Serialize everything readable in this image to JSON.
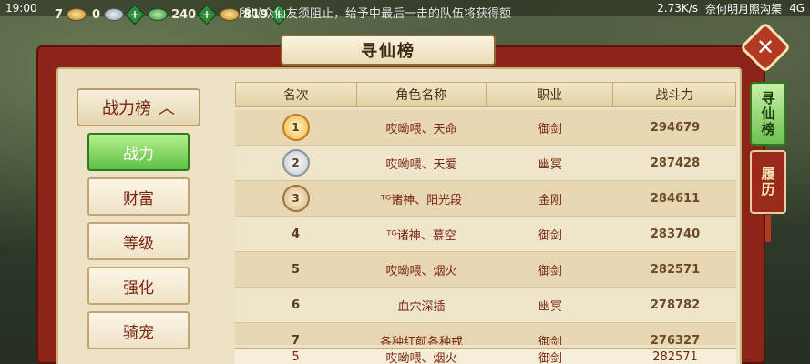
{
  "status_bar": {
    "time": "19:00",
    "net_speed": "2.73K/s",
    "carrier": "奈何明月照沟渠",
    "network": "4G"
  },
  "resources": [
    {
      "icon": "gold-coin-icon",
      "value": "7"
    },
    {
      "icon": "silver-coin-icon",
      "value": "0"
    },
    {
      "icon": "jade-icon",
      "value": "240"
    },
    {
      "icon": "ingot-icon",
      "value": "819"
    }
  ],
  "marquee_text": "所以众仙友须阻止，给予中最后一击的队伍将获得额",
  "panel": {
    "title": "寻仙榜"
  },
  "category": {
    "header": "战力榜",
    "items": [
      "战力",
      "财富",
      "等级",
      "强化",
      "骑宠"
    ],
    "active_index": 0
  },
  "table": {
    "columns": [
      "名次",
      "角色名称",
      "职业",
      "战斗力"
    ],
    "rows": [
      {
        "rank": "1",
        "name": "哎呦喂、天命",
        "class": "御剑",
        "power": "294679"
      },
      {
        "rank": "2",
        "name": "哎呦喂、天爱",
        "class": "幽冥",
        "power": "287428"
      },
      {
        "rank": "3",
        "name": "ᵀᴳ诸神、阳光段",
        "class": "金刚",
        "power": "284611"
      },
      {
        "rank": "4",
        "name": "ᵀᴳ诸神、慕空",
        "class": "御剑",
        "power": "283740"
      },
      {
        "rank": "5",
        "name": "哎呦喂、烟火",
        "class": "御剑",
        "power": "282571"
      },
      {
        "rank": "6",
        "name": "血穴深插",
        "class": "幽冥",
        "power": "278782"
      },
      {
        "rank": "7",
        "name": "各种红颜各种戒",
        "class": "御剑",
        "power": "276327"
      }
    ],
    "my_row": {
      "rank": "5",
      "name": "哎呦喂、烟火",
      "class": "御剑",
      "power": "282571"
    }
  },
  "side_tabs": [
    {
      "label": "寻仙榜",
      "active": true
    },
    {
      "label": "履历",
      "active": false
    }
  ],
  "colors": {
    "panel_red": "#8c2418",
    "active_green": "#5fbf48",
    "text_red": "#7a2412"
  }
}
